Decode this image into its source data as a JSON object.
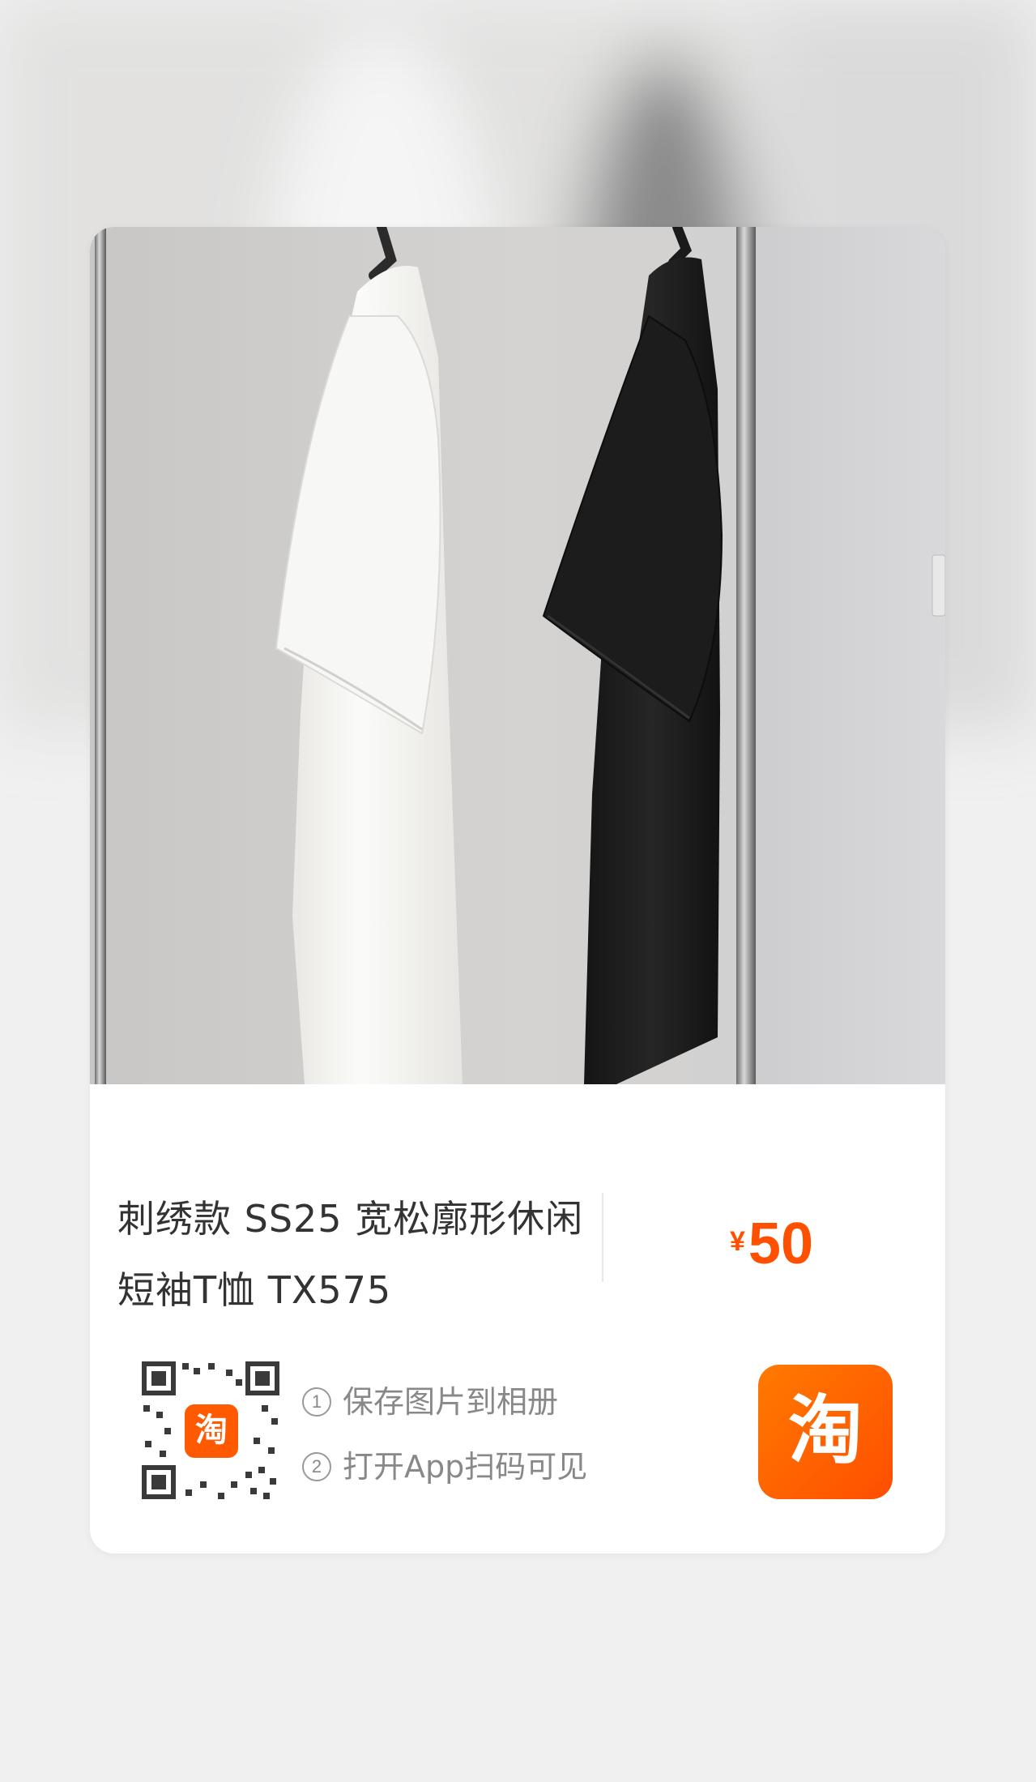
{
  "product": {
    "title_line1": "刺绣款 SS25 宽松廓形休闲",
    "title_line2": "短袖T恤 TX575",
    "price_symbol": "¥",
    "price_value": "50"
  },
  "share": {
    "step1_num": "1",
    "step1_text": "保存图片到相册",
    "step2_num": "2",
    "step2_text": "打开App扫码可见",
    "app_logo_char": "淘",
    "qr_logo_char": "淘"
  },
  "colors": {
    "accent": "#ff5000",
    "badge_gradient_start": "#ff7a00",
    "badge_gradient_end": "#ff4e00"
  },
  "icons": [
    "qr-code-icon",
    "taobao-app-icon",
    "step-one-icon",
    "step-two-icon"
  ]
}
